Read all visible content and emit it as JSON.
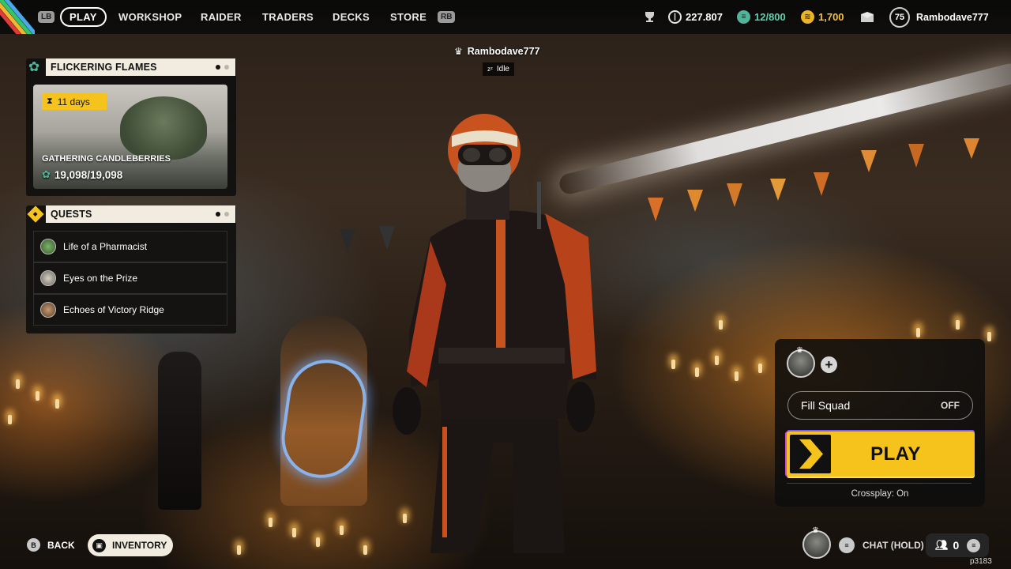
{
  "topbar": {
    "lb": "LB",
    "rb": "RB",
    "tabs": [
      {
        "label": "PLAY",
        "active": true
      },
      {
        "label": "WORKSHOP",
        "active": false
      },
      {
        "label": "RAIDER",
        "active": false
      },
      {
        "label": "TRADERS",
        "active": false
      },
      {
        "label": "DECKS",
        "active": false
      },
      {
        "label": "STORE",
        "active": false
      }
    ],
    "currency_coins": "227.807",
    "currency_capacity": "12/800",
    "currency_tokens": "1,700",
    "player_level": "75",
    "player_name": "Rambodave777",
    "icons": [
      "trophy-icon",
      "coin-icon",
      "capacity-icon",
      "token-icon",
      "mail-icon"
    ]
  },
  "event": {
    "title": "FLICKERING FLAMES",
    "timer": "11 days",
    "task": "GATHERING CANDLEBERRIES",
    "progress_text": "19,098/19,098",
    "progress_fraction": 1.0
  },
  "quests": {
    "title": "QUESTS",
    "items": [
      {
        "label": "Life of a Pharmacist"
      },
      {
        "label": "Eyes on the Prize"
      },
      {
        "label": "Echoes of Victory Ridge"
      }
    ]
  },
  "character": {
    "name": "Rambodave777",
    "status": "Idle"
  },
  "squad": {
    "fill_squad_label": "Fill Squad",
    "fill_squad_value": "OFF",
    "play_label": "PLAY",
    "crossplay": "Crossplay: On"
  },
  "bottom": {
    "back_key": "B",
    "back_label": "BACK",
    "inventory_label": "INVENTORY",
    "chat_label": "CHAT (HOLD)",
    "party_count": "0",
    "build_id": "p3183"
  },
  "colors": {
    "accent_yellow": "#f6c31c",
    "panel_cream": "#f1ecdf",
    "event_green": "#4fb59a"
  }
}
